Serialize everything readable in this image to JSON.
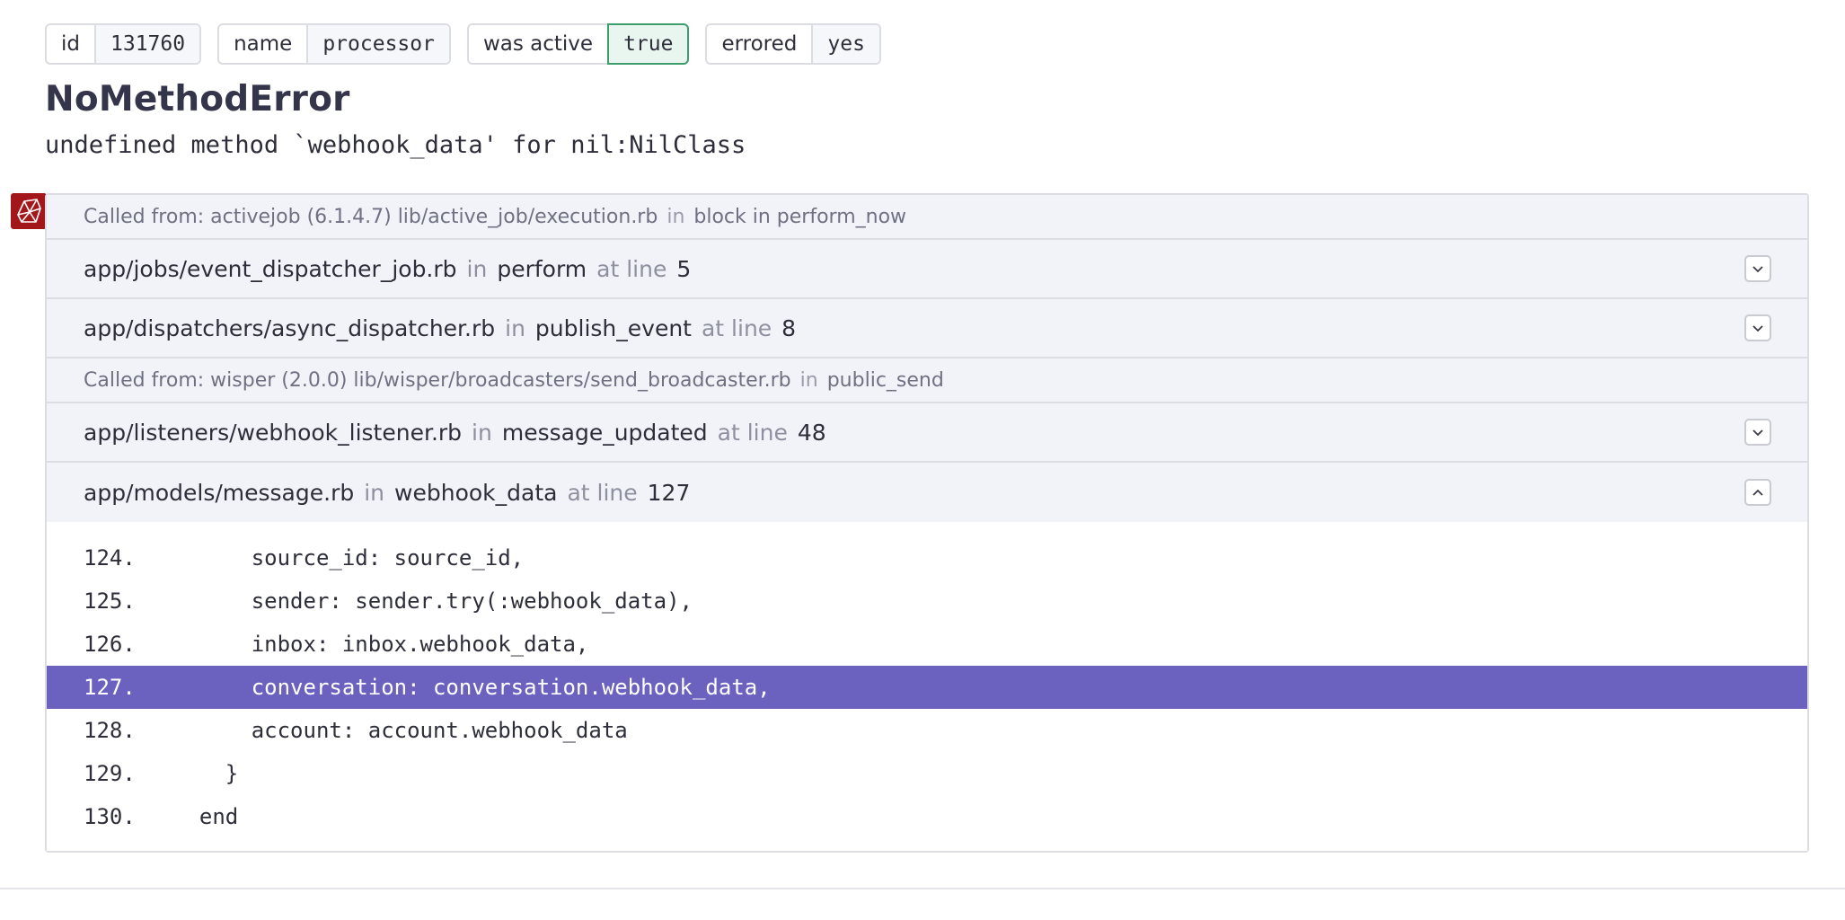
{
  "pills": [
    {
      "key": "id",
      "value": "131760",
      "state": "normal"
    },
    {
      "key": "name",
      "value": "processor",
      "state": "normal"
    },
    {
      "key": "was active",
      "value": "true",
      "state": "active-true"
    },
    {
      "key": "errored",
      "value": "yes",
      "state": "normal"
    }
  ],
  "error": {
    "title": "NoMethodError",
    "message": "undefined method `webhook_data' for nil:NilClass"
  },
  "backtrace": {
    "in_word": "in",
    "at_line_word": "at line",
    "called_from_1": {
      "label": "Called from: activejob (6.1.4.7) lib/active_job/execution.rb",
      "method": "block in perform_now"
    },
    "frames": [
      {
        "file": "app/jobs/event_dispatcher_job.rb",
        "method": "perform",
        "line": "5"
      },
      {
        "file": "app/dispatchers/async_dispatcher.rb",
        "method": "publish_event",
        "line": "8"
      }
    ],
    "called_from_2": {
      "label": "Called from: wisper (2.0.0) lib/wisper/broadcasters/send_broadcaster.rb",
      "method": "public_send"
    },
    "frames_2": [
      {
        "file": "app/listeners/webhook_listener.rb",
        "method": "message_updated",
        "line": "48"
      }
    ],
    "expanded_frame": {
      "file": "app/models/message.rb",
      "method": "webhook_data",
      "line": "127"
    },
    "code_lines": [
      {
        "num": "124.",
        "code": "      source_id: source_id,"
      },
      {
        "num": "125.",
        "code": "      sender: sender.try(:webhook_data),"
      },
      {
        "num": "126.",
        "code": "      inbox: inbox.webhook_data,"
      },
      {
        "num": "127.",
        "code": "      conversation: conversation.webhook_data,"
      },
      {
        "num": "128.",
        "code": "      account: account.webhook_data"
      },
      {
        "num": "129.",
        "code": "    }"
      },
      {
        "num": "130.",
        "code": "  end"
      }
    ],
    "highlight_line": "127."
  },
  "colors": {
    "highlight": "#6b61be",
    "active_green": "#3f9c6d",
    "ruby_red": "#a3171b"
  }
}
